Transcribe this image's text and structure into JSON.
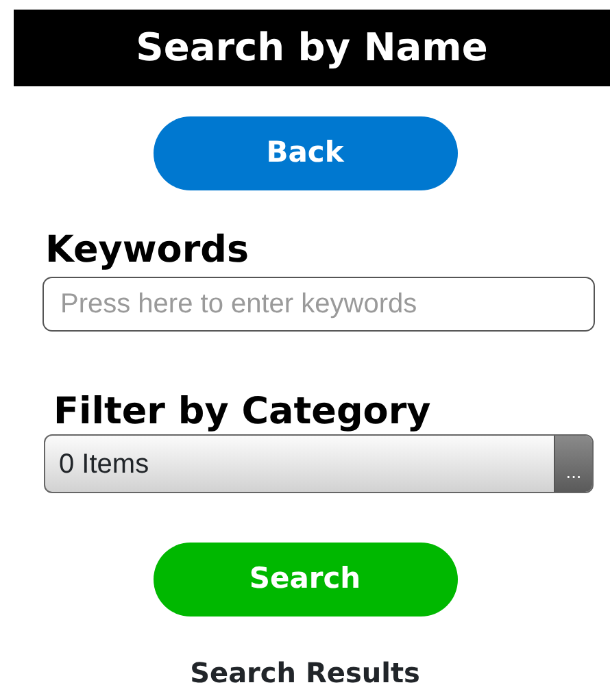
{
  "title": "Search by Name",
  "back_button": {
    "label": "Back"
  },
  "keywords": {
    "label": "Keywords",
    "placeholder": "Press here to enter keywords"
  },
  "category_filter": {
    "label": "Filter by Category",
    "value": "0 Items",
    "picker_label": "..."
  },
  "search_button": {
    "label": "Search"
  },
  "results_heading": "Search Results"
}
